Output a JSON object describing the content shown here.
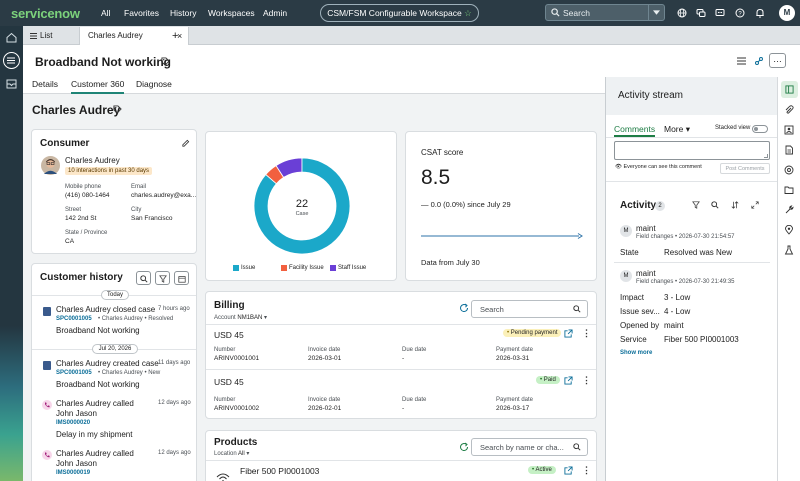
{
  "topbar": {
    "logo": "servicenow",
    "nav": [
      "All",
      "Favorites",
      "History",
      "Workspaces",
      "Admin"
    ],
    "workspace_label": "CSM/FSM Configurable Workspace",
    "search_placeholder": "Search",
    "avatar_initial": "M"
  },
  "tabs": {
    "list_label": "List",
    "record_tab": "Charles Audrey",
    "add": "+"
  },
  "record": {
    "title": "Broadband Not working",
    "subtabs": [
      "Details",
      "Customer 360",
      "Diagnose"
    ],
    "active_subtab": "Customer 360"
  },
  "customer": {
    "name": "Charles Audrey"
  },
  "consumer": {
    "title": "Consumer",
    "name": "Charles Audrey",
    "interactions": "10 interactions in past 30 days",
    "mobile_label": "Mobile phone",
    "mobile": "(416) 080-1464",
    "email_label": "Email",
    "email": "charles.audrey@exa...",
    "street_label": "Street",
    "street": "142 2nd St",
    "city_label": "City",
    "city": "San Francisco",
    "state_label": "State / Province",
    "state": "CA"
  },
  "donut": {
    "center_value": "22",
    "center_label": "Case",
    "legend": [
      "Issue",
      "Facility Issue",
      "Staff Issue"
    ],
    "colors": [
      "#1ba8c9",
      "#f2603f",
      "#6a3fd6"
    ],
    "values": [
      19,
      1,
      2
    ]
  },
  "csat": {
    "title": "CSAT score",
    "score": "8.5",
    "change": "— 0.0 (0.0%) since July 29",
    "footer": "Data from July 30"
  },
  "history": {
    "title": "Customer history",
    "chip_today": "Today",
    "chip_date": "Jul 20, 2026",
    "items": [
      {
        "title": "Charles Audrey closed case",
        "time": "7 hours ago",
        "number": "SPC0001005",
        "meta": "• Charles Audrey  • Resolved",
        "desc": "Broadband Not working"
      },
      {
        "title": "Charles Audrey created case",
        "time": "11 days ago",
        "number": "SPC0001005",
        "meta": "• Charles Audrey  • New",
        "desc": "Broadband Not working"
      },
      {
        "title": "Charles Audrey called John Jason",
        "time": "12 days ago",
        "number": "IMS0000020",
        "meta": "",
        "desc": "Delay in my shipment"
      },
      {
        "title": "Charles Audrey called John Jason",
        "time": "12 days ago",
        "number": "IMS0000019",
        "meta": "",
        "desc": ""
      }
    ]
  },
  "billing": {
    "title": "Billing",
    "account_label": "Account",
    "account": "NM1BAN",
    "search_placeholder": "Search",
    "rows": [
      {
        "amount": "USD 45",
        "status": "Pending payment",
        "number_label": "Number",
        "number": "ARINV0001001",
        "invoice_label": "Invoice date",
        "invoice": "2026-03-01",
        "due_label": "Due date",
        "due": "-",
        "paydate_label": "Payment date",
        "paydate": "2026-03-31"
      },
      {
        "amount": "USD 45",
        "status": "Paid",
        "number_label": "Number",
        "number": "ARINV0001002",
        "invoice_label": "Invoice date",
        "invoice": "2026-02-01",
        "due_label": "Due date",
        "due": "-",
        "paydate_label": "Payment date",
        "paydate": "2026-03-17"
      }
    ]
  },
  "products": {
    "title": "Products",
    "location_label": "Location",
    "location": "All",
    "search_placeholder": "Search by name or cha...",
    "item_name": "Fiber 500 PI0001003",
    "item_status": "Active"
  },
  "activity": {
    "title": "Activity stream",
    "tab_comments": "Comments",
    "tab_more": "More",
    "stacked_view": "Stacked view",
    "visibility_note": "Everyone can see this comment",
    "post_button": "Post Comments",
    "section_title": "Activity",
    "count": "2",
    "entries": [
      {
        "user": "maint",
        "meta": "Field changes • 2026-07-30 21:54:57",
        "rows": [
          {
            "label": "State",
            "value": "Resolved was New"
          }
        ]
      },
      {
        "user": "maint",
        "meta": "Field changes • 2026-07-30 21:49:35",
        "rows": [
          {
            "label": "Impact",
            "value": "3 - Low"
          },
          {
            "label": "Issue sev...",
            "value": "4 - Low"
          },
          {
            "label": "Opened by",
            "value": "maint"
          },
          {
            "label": "Service",
            "value": "Fiber 500 PI0001003"
          }
        ]
      }
    ],
    "show_more": "Show more"
  }
}
